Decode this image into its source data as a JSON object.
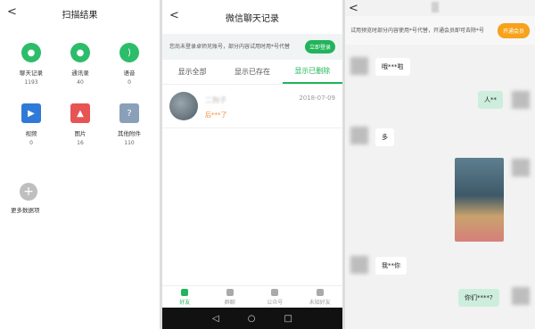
{
  "scan": {
    "back_label": "<",
    "title": "扫描结果",
    "items": [
      {
        "label": "聊天记录",
        "count": "1193",
        "color": "#2cbd6a",
        "icon": "chat-icon"
      },
      {
        "label": "通讯录",
        "count": "40",
        "color": "#2cbd6a",
        "icon": "contacts-icon"
      },
      {
        "label": "语音",
        "count": "0",
        "color": "#2cbd6a",
        "icon": "voice-icon"
      },
      {
        "label": "视频",
        "count": "0",
        "color": "#2f7ad8",
        "icon": "video-icon"
      },
      {
        "label": "图片",
        "count": "16",
        "color": "#e65454",
        "icon": "image-icon"
      },
      {
        "label": "其他附件",
        "count": "110",
        "color": "#8aa0b8",
        "icon": "attachment-icon"
      }
    ],
    "more_label": "更多数据项"
  },
  "records": {
    "back_label": "<",
    "title": "微信聊天记录",
    "banner_text": "您尚未登录卓师兄账号，部分内容试用时用*号代替",
    "login_button": "立即登录",
    "tabs": [
      "显示全部",
      "显示已存在",
      "显示已删除"
    ],
    "active_tab": 2,
    "contact": {
      "name": "二狗子",
      "message": "后***了",
      "date": "2018-07-09"
    },
    "nav": [
      "好友",
      "群聊",
      "公众号",
      "未知好友"
    ],
    "sys_icons": [
      "◁",
      "○",
      "□"
    ]
  },
  "chat": {
    "back_label": "<",
    "banner_text": "试用预览时部分内容使用*号代替，开通会员即可去除*号",
    "vip_button": "开通会员",
    "messages": [
      {
        "side": "left",
        "text": "哦***啦"
      },
      {
        "side": "right",
        "text": "人**"
      },
      {
        "side": "left",
        "text": "多"
      },
      {
        "side": "left",
        "text": "我**你"
      },
      {
        "side": "right",
        "text": "你们****?"
      }
    ]
  },
  "colors": {
    "green": "#21b45a",
    "orange": "#f7a21a",
    "deleted_msg": "#f08a2c"
  }
}
